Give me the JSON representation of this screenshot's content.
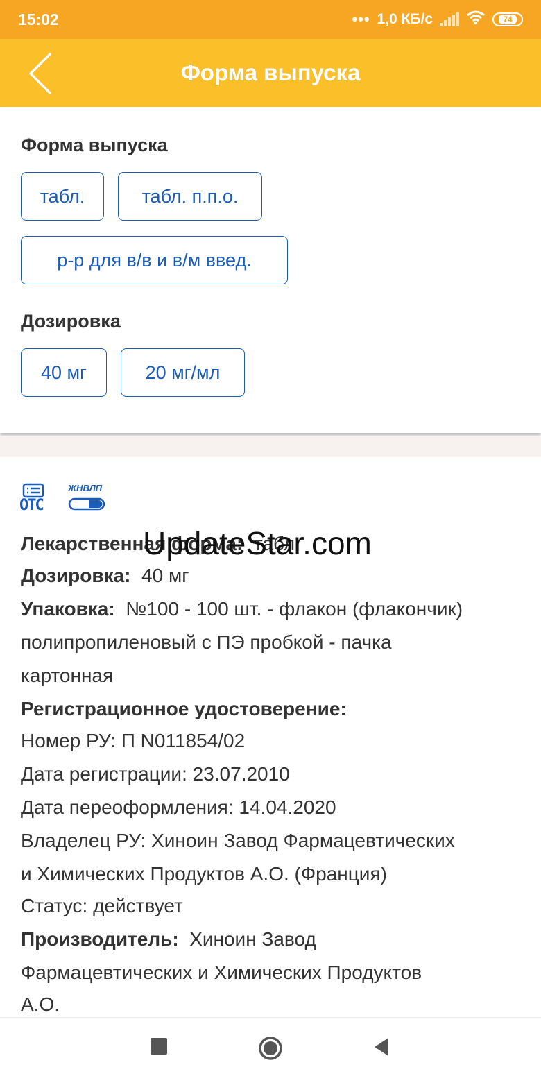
{
  "status_bar": {
    "time": "15:02",
    "network_speed": "1,0 КБ/с",
    "battery_level": "74",
    "icons": [
      "signal-icon",
      "wifi-icon",
      "battery-icon"
    ]
  },
  "app_bar": {
    "title": "Форма выпуска",
    "back_icon": "chevron-left-icon"
  },
  "filters": {
    "form_label": "Форма выпуска",
    "form_options": [
      "табл.",
      "табл. п.п.о.",
      "р-р для в/в и в/м введ."
    ],
    "dosage_label": "Дозировка",
    "dosage_options": [
      "40 мг",
      "20 мг/мл"
    ]
  },
  "detail": {
    "badges": [
      {
        "icon": "otc-icon",
        "text": "OTC"
      },
      {
        "icon": "zhnvlp-icon",
        "text": "ЖНВЛП"
      }
    ],
    "watermark": "UpdateStar.com",
    "form_label": "Лекарственная форма:",
    "form_value": "табл.",
    "dosage_label": "Дозировка:",
    "dosage_value": "40 мг",
    "package_label": "Упаковка:",
    "package_value_1": "№100 - 100 шт. - флакон (флакончик)",
    "package_value_2": "полипропиленовый с ПЭ пробкой - пачка",
    "package_value_3": "картонная",
    "reg_label": "Регистрационное удостоверение:",
    "reg_number": "Номер РУ: П N011854/02",
    "reg_date": "Дата регистрации: 23.07.2010",
    "reissue_date": "Дата переоформления: 14.04.2020",
    "owner_1": "Владелец РУ: Хиноин Завод Фармацевтических",
    "owner_2": "и Химических Продуктов А.О. (Франция)",
    "status": "Статус: действует",
    "manufacturer_label": "Производитель:",
    "manufacturer_value_1": "Хиноин Завод",
    "manufacturer_value_2": "Фармацевтических и Химических Продуктов",
    "manufacturer_value_3": "А.О."
  },
  "nav_bar": {
    "icons": [
      "recents-square-icon",
      "home-circle-icon",
      "back-triangle-icon"
    ]
  },
  "colors": {
    "status_bar": "#F6A623",
    "app_bar": "#FBBF2A",
    "chip_blue": "#1A5CB8"
  }
}
